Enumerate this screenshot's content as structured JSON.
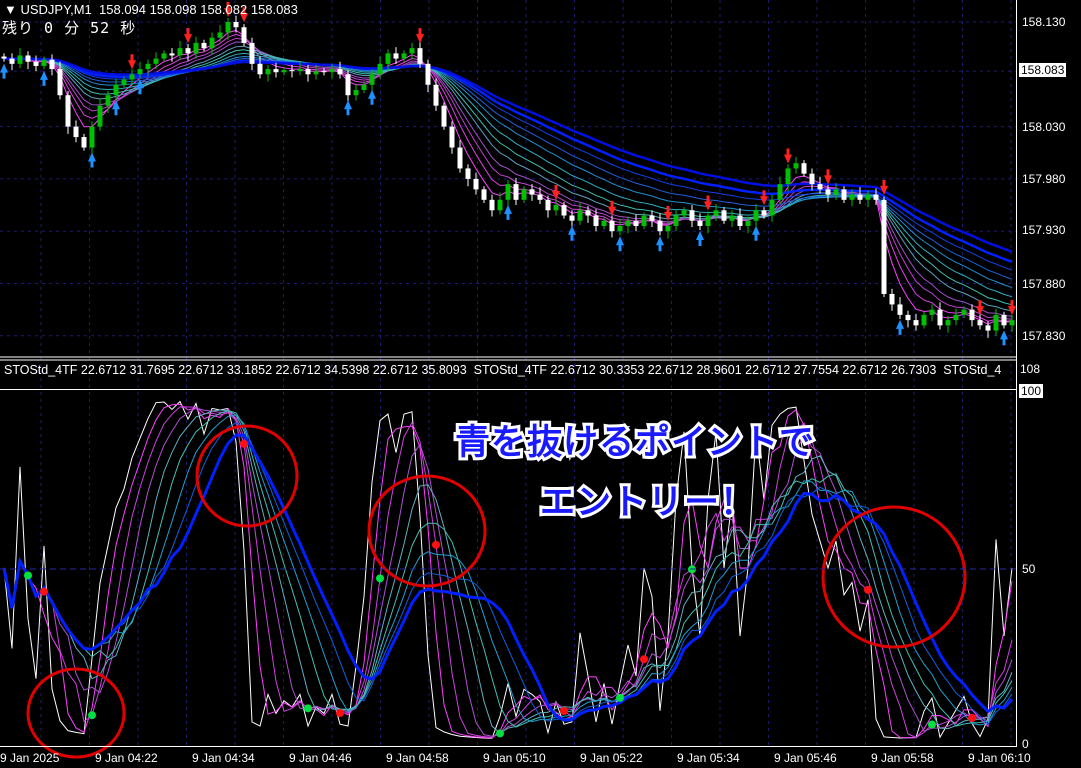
{
  "header": {
    "symbol": "USDJPY,M1",
    "ohlc": "158.094 158.098 158.082 158.083",
    "countdown": "残り 0 分 52 秒"
  },
  "price_axis": {
    "labels": [
      "158.130",
      "158.030",
      "157.980",
      "157.930",
      "157.880",
      "157.830"
    ],
    "current_price": "158.083"
  },
  "indicator": {
    "label": "STOStd_4TF 22.6712 31.7695 22.6712 33.1852 22.6712 34.5398 22.6712 35.8093  STOStd_4TF 22.6712 30.3353 22.6712 28.9601 22.6712 27.7554 22.6712 26.7303  STOStd_4",
    "axis": {
      "max_label": "108",
      "top": "100",
      "mid": "50",
      "bottom": "0"
    }
  },
  "time_axis": [
    "9 Jan 2025",
    "9 Jan 04:22",
    "9 Jan 04:34",
    "9 Jan 04:46",
    "9 Jan 04:58",
    "9 Jan 05:10",
    "9 Jan 05:22",
    "9 Jan 05:34",
    "9 Jan 05:46",
    "9 Jan 05:58",
    "9 Jan 06:10"
  ],
  "annotation": {
    "line1": "青を抜けるポイントで",
    "line2": "エントリー！"
  },
  "colors": {
    "bull": "#00c000",
    "bear": "#ffffff",
    "grid": "#1c1c6e",
    "sell_arrow": "#ff2020",
    "buy_arrow": "#1e90ff",
    "circle": "#e00000"
  },
  "chart_data": {
    "type": "candlestick",
    "closes": [
      158.095,
      158.09,
      158.098,
      158.092,
      158.088,
      158.094,
      158.085,
      158.06,
      158.03,
      158.02,
      158.01,
      158.03,
      158.05,
      158.06,
      158.07,
      158.075,
      158.08,
      158.085,
      158.09,
      158.095,
      158.1,
      158.098,
      158.105,
      158.1,
      158.11,
      158.105,
      158.115,
      158.12,
      158.13,
      158.125,
      158.11,
      158.09,
      158.08,
      158.085,
      158.082,
      158.084,
      158.083,
      158.085,
      158.08,
      158.083,
      158.082,
      158.085,
      158.08,
      158.06,
      158.065,
      158.07,
      158.08,
      158.09,
      158.1,
      158.095,
      158.1,
      158.105,
      158.09,
      158.07,
      158.05,
      158.03,
      158.01,
      157.99,
      157.98,
      157.97,
      157.96,
      157.95,
      157.96,
      157.975,
      157.96,
      157.97,
      157.965,
      157.96,
      157.95,
      157.955,
      157.945,
      157.94,
      157.95,
      157.945,
      157.935,
      157.94,
      157.93,
      157.935,
      157.94,
      157.935,
      157.945,
      157.94,
      157.93,
      157.935,
      157.945,
      157.95,
      157.94,
      157.935,
      157.945,
      157.95,
      157.94,
      157.945,
      157.935,
      157.94,
      157.95,
      157.945,
      157.96,
      157.975,
      157.99,
      157.995,
      157.985,
      157.975,
      157.97,
      157.965,
      157.97,
      157.96,
      157.965,
      157.96,
      157.965,
      157.96,
      157.87,
      157.86,
      157.85,
      157.845,
      157.84,
      157.85,
      157.855,
      157.84,
      157.845,
      157.85,
      157.855,
      157.845,
      157.84,
      157.835,
      157.85,
      157.84,
      157.845
    ],
    "price_range": [
      157.812,
      158.15
    ],
    "sell_signals": [
      16,
      23,
      28,
      30,
      52,
      69,
      76,
      83,
      88,
      95,
      98,
      103,
      110,
      122,
      126
    ],
    "buy_signals": [
      0,
      5,
      11,
      14,
      17,
      43,
      46,
      63,
      71,
      77,
      82,
      87,
      94,
      112,
      125
    ],
    "stoch_range": [
      0,
      100
    ],
    "green_dots": [
      3,
      11,
      38,
      47,
      62,
      77,
      86,
      116
    ],
    "red_dots": [
      5,
      30,
      42,
      54,
      70,
      80,
      108,
      121
    ]
  }
}
